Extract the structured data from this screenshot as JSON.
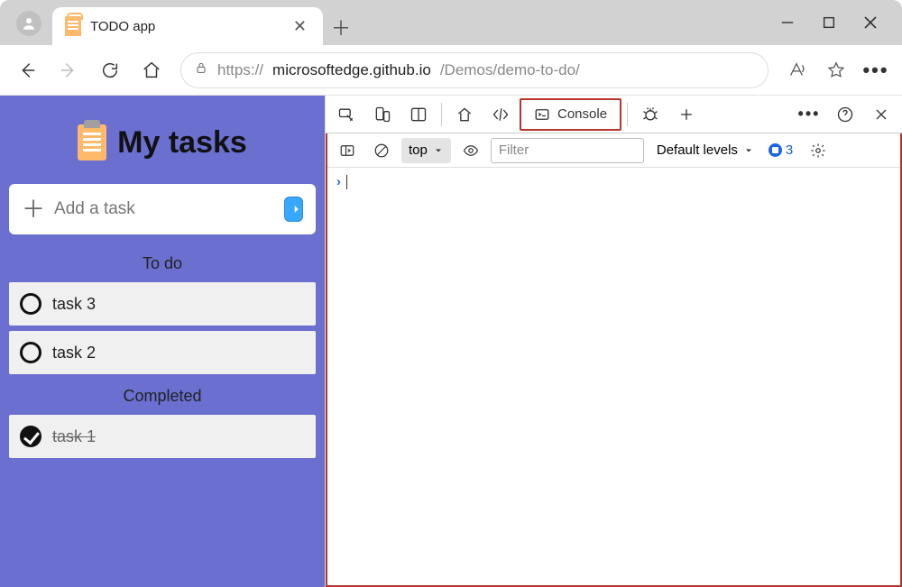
{
  "window": {
    "tab_title": "TODO app",
    "new_tab": "+",
    "minimize": "—",
    "maximize": "□",
    "close": "✕"
  },
  "addressbar": {
    "url_proto": "https://",
    "url_host": "microsoftedge.github.io",
    "url_path": "/Demos/demo-to-do/"
  },
  "page": {
    "heading": "My tasks",
    "add_placeholder": "Add a task",
    "section_todo": "To do",
    "section_completed": "Completed",
    "todo_items": [
      "task 3",
      "task 2"
    ],
    "completed_items": [
      "task 1"
    ]
  },
  "devtools": {
    "console_tab": "Console",
    "context": "top",
    "filter_placeholder": "Filter",
    "levels_label": "Default levels",
    "issue_count": "3"
  }
}
